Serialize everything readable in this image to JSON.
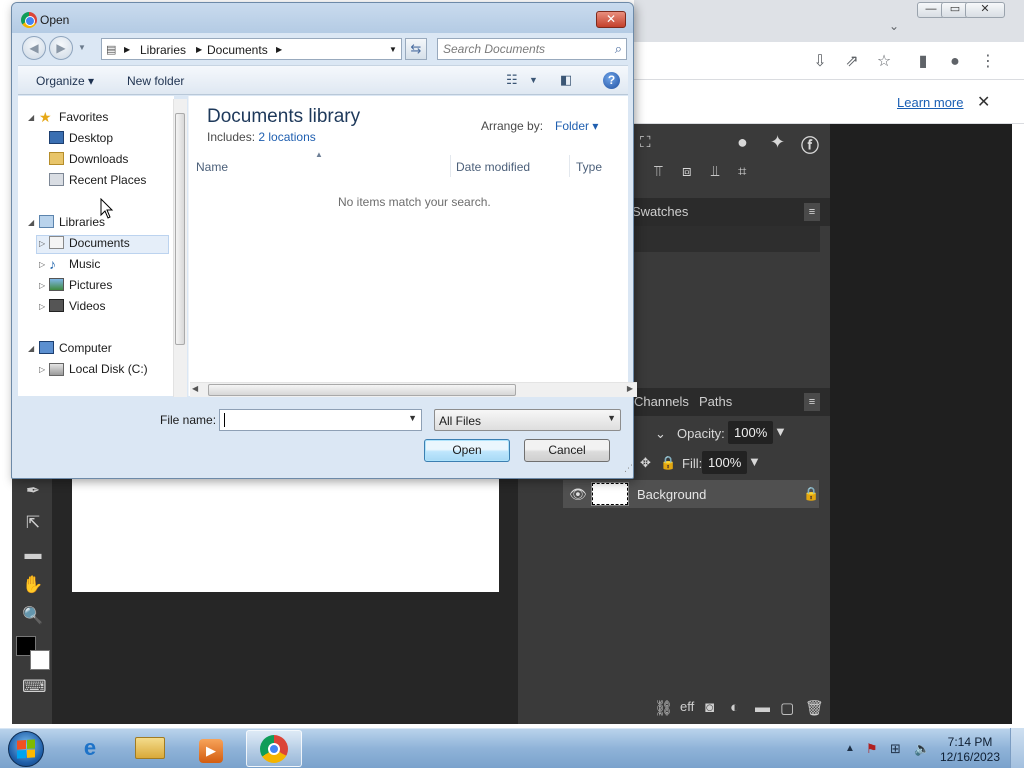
{
  "dialog": {
    "title": "Open",
    "close_label": "✕",
    "address": {
      "separator": "▶",
      "crumbs": [
        "Libraries",
        "Documents"
      ]
    },
    "search": {
      "placeholder": "Search Documents"
    },
    "commands": {
      "organize": "Organize ▾",
      "new_folder": "New folder"
    },
    "nav_tree": {
      "favorites": "Favorites",
      "desktop": "Desktop",
      "downloads": "Downloads",
      "recent_places": "Recent Places",
      "libraries": "Libraries",
      "documents": "Documents",
      "music": "Music",
      "pictures": "Pictures",
      "videos": "Videos",
      "computer": "Computer",
      "local_disk": "Local Disk (C:)"
    },
    "library": {
      "title": "Documents library",
      "includes_label": "Includes:",
      "includes_link": "2 locations",
      "arrange_label": "Arrange by:",
      "arrange_value": "Folder ▾"
    },
    "columns": [
      "Name",
      "Date modified",
      "Type"
    ],
    "empty_message": "No items match your search.",
    "file_name_label": "File name:",
    "file_name_value": "",
    "file_type": "All Files",
    "open_label": "Open",
    "cancel_label": "Cancel"
  },
  "browser": {
    "learn_more": "Learn more"
  },
  "editor": {
    "panel_swatches": "Swatches",
    "panel_channels": "Channels",
    "panel_paths": "Paths",
    "opacity_label": "Opacity:",
    "opacity_value": "100%",
    "fill_label": "Fill:",
    "fill_value": "100%",
    "layer_name": "Background"
  },
  "taskbar": {
    "time": "7:14 PM",
    "date": "12/16/2023"
  }
}
